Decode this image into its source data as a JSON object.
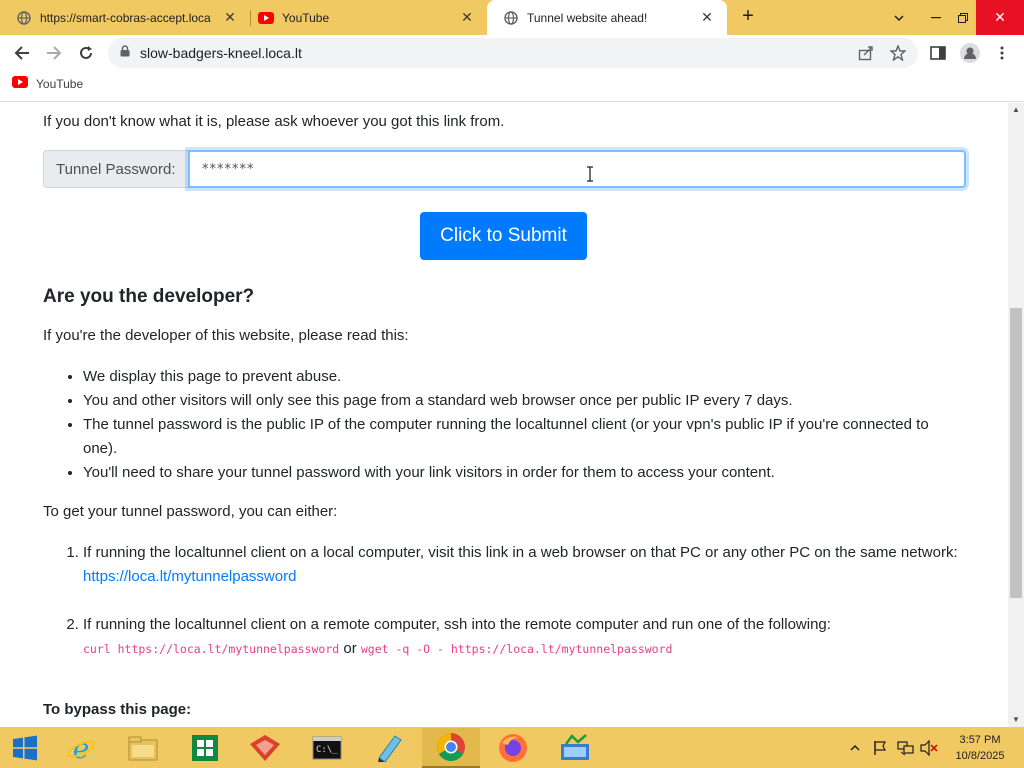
{
  "tabs": [
    {
      "title": "https://smart-cobras-accept.loca",
      "favicon": "globe-icon"
    },
    {
      "title": "YouTube",
      "favicon": "youtube-icon"
    },
    {
      "title": "Tunnel website ahead!",
      "favicon": "globe-icon",
      "active": true
    }
  ],
  "toolbar": {
    "url": "slow-badgers-kneel.loca.lt"
  },
  "bookmarks": [
    {
      "label": "YouTube",
      "icon": "youtube-icon"
    }
  ],
  "page": {
    "intro": "If you don't know what it is, please ask whoever you got this link from.",
    "password_label": "Tunnel Password:",
    "password_value": "*******",
    "submit_label": "Click to Submit",
    "dev_heading": "Are you the developer?",
    "dev_text": "If you're the developer of this website, please read this:",
    "bullets": [
      "We display this page to prevent abuse.",
      "You and other visitors will only see this page from a standard web browser once per public IP every 7 days.",
      "The tunnel password is the public IP of the computer running the localtunnel client (or your vpn's public IP if you're connected to one).",
      "You'll need to share your tunnel password with your link visitors in order for them to access your content."
    ],
    "get_password_text": "To get your tunnel password, you can either:",
    "step1_text": "If running the localtunnel client on a local computer, visit this link in a web browser on that PC or any other PC on the same network: ",
    "step1_link": "https://loca.lt/mytunnelpassword",
    "step2_text": "If running the localtunnel client on a remote computer, ssh into the remote computer and run one of the following:",
    "step2_code1": "curl https://loca.lt/mytunnelpassword",
    "step2_or": "or",
    "step2_code2": "wget -q -O - https://loca.lt/mytunnelpassword",
    "bypass_heading": "To bypass this page:"
  },
  "taskbar": {
    "apps": [
      "start-icon",
      "internet-explorer-icon",
      "file-explorer-icon",
      "store-icon",
      "app-icon",
      "terminal-icon",
      "notepad-icon",
      "chrome-icon",
      "firefox-icon",
      "app2-icon"
    ],
    "time": "3:57 PM",
    "date": "10/8/2025"
  },
  "colors": {
    "chrome_accent": "#f1c962",
    "link": "#007bff",
    "button": "#007bff",
    "code": "#e83e8c"
  }
}
